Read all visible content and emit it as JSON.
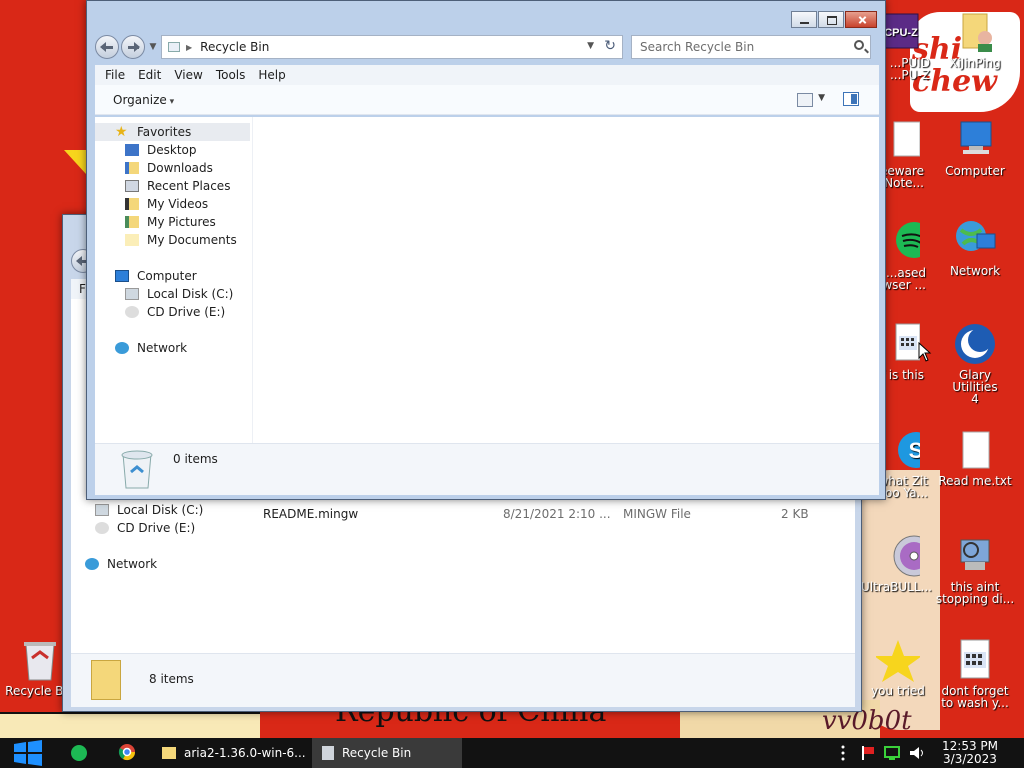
{
  "wallpaper": {
    "banner_text": "Republic of China",
    "sticker_text": "shi chew",
    "signature": "vv0b0t"
  },
  "desktop_icons": {
    "cpuz": {
      "label": "...PUID\n...PU-Z"
    },
    "xiutinping": {
      "label": "XiJinPing"
    },
    "freeware": {
      "label": "...eeware\nNote..."
    },
    "computer": {
      "label": "Computer"
    },
    "based": {
      "label": "...ased\n...wser ..."
    },
    "network": {
      "label": "Network"
    },
    "whatisthis": {
      "label": "...f is this"
    },
    "glary": {
      "label": "Glary Utilities\n4"
    },
    "skype": {
      "label": "...what Zit\n...oo Ya..."
    },
    "readme": {
      "label": "Read me.txt"
    },
    "ultrabull": {
      "label": "UltraBULL..."
    },
    "aint": {
      "label": "this aint\nstopping di..."
    },
    "recycle": {
      "label": "Recycle B..."
    },
    "youtried": {
      "label": "you tried"
    },
    "dontforget": {
      "label": "dont forget\nto wash y..."
    }
  },
  "back_window": {
    "nav": {
      "local_disk": "Local Disk (C:)",
      "cd_drive": "CD Drive (E:)",
      "network": "Network"
    },
    "file_row": {
      "name": "README.mingw",
      "date": "8/21/2021 2:10 ...",
      "type": "MINGW File",
      "size": "2 KB"
    },
    "status_count": "8 items",
    "menu_initial": "F"
  },
  "front_window": {
    "address": "Recycle Bin",
    "search_placeholder": "Search Recycle Bin",
    "menu": [
      "File",
      "Edit",
      "View",
      "Tools",
      "Help"
    ],
    "organize_label": "Organize",
    "nav": {
      "favorites": "Favorites",
      "desktop": "Desktop",
      "downloads": "Downloads",
      "recent": "Recent Places",
      "videos": "My Videos",
      "pictures": "My Pictures",
      "documents": "My Documents",
      "computer": "Computer",
      "local_disk": "Local Disk (C:)",
      "cd_drive": "CD Drive (E:)",
      "network": "Network"
    },
    "status_count": "0 items"
  },
  "taskbar": {
    "task1": "aria2-1.36.0-win-6...",
    "task2": "Recycle Bin",
    "time": "12:53 PM",
    "date": "3/3/2023"
  }
}
